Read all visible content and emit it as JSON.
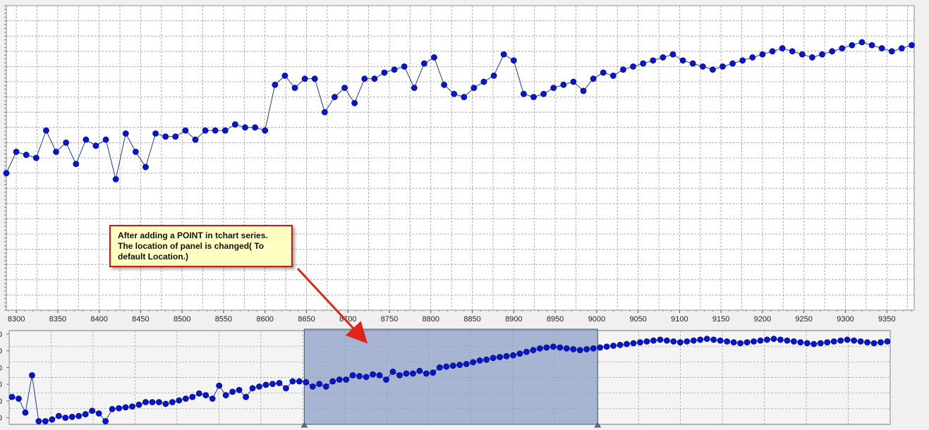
{
  "chart_data": [
    {
      "type": "line",
      "x_ticks": [
        8300,
        8350,
        8400,
        8450,
        8500,
        8550,
        8600,
        8650,
        8700,
        8750,
        8800,
        8850,
        8900,
        8950,
        9000,
        9050,
        9100,
        9150,
        9200,
        9250,
        9300,
        9350
      ],
      "xlim": [
        8288,
        9383
      ],
      "ylim": [
        0,
        100
      ],
      "grid": true,
      "marker": "circle",
      "series": [
        {
          "x": [
            8288,
            8300,
            8312,
            8324,
            8336,
            8348,
            8360,
            8372,
            8384,
            8396,
            8408,
            8420,
            8432,
            8444,
            8456,
            8468,
            8480,
            8492,
            8504,
            8516,
            8528,
            8540,
            8552,
            8564,
            8576,
            8588,
            8600,
            8612,
            8624,
            8636,
            8648,
            8660,
            8672,
            8684,
            8696,
            8708,
            8720,
            8732,
            8744,
            8756,
            8768,
            8780,
            8792,
            8804,
            8816,
            8828,
            8840,
            8852,
            8864,
            8876,
            8888,
            8900,
            8912,
            8924,
            8936,
            8948,
            8960,
            8972,
            8984,
            8996,
            9008,
            9020,
            9032,
            9044,
            9056,
            9068,
            9080,
            9092,
            9104,
            9116,
            9128,
            9140,
            9152,
            9164,
            9176,
            9188,
            9200,
            9212,
            9224,
            9236,
            9248,
            9260,
            9272,
            9284,
            9296,
            9308,
            9320,
            9332,
            9344,
            9356,
            9368,
            9380
          ],
          "values": [
            45,
            52,
            51,
            50,
            59,
            52,
            55,
            48,
            56,
            54,
            56,
            43,
            58,
            52,
            47,
            58,
            57,
            57,
            59,
            56,
            59,
            59,
            59,
            61,
            60,
            60,
            59,
            74,
            77,
            73,
            76,
            76,
            65,
            70,
            73,
            68,
            76,
            76,
            78,
            79,
            80,
            73,
            81,
            83,
            74,
            71,
            70,
            73,
            75,
            77,
            84,
            82,
            71,
            70,
            71,
            73,
            74,
            75,
            72,
            76,
            78,
            77,
            79,
            80,
            81,
            82,
            83,
            84,
            82,
            81,
            80,
            79,
            80,
            81,
            82,
            83,
            84,
            85,
            86,
            85,
            84,
            83,
            84,
            85,
            86,
            87,
            88,
            87,
            86,
            85,
            86,
            87
          ]
        }
      ]
    },
    {
      "type": "line",
      "x_ticks": [],
      "xlim": [
        0,
        100
      ],
      "ylim": [
        0,
        100
      ],
      "y_ticks": [
        "0",
        "0",
        "0",
        "0",
        "0",
        "0"
      ],
      "grid": true,
      "marker": "circle",
      "selection": {
        "from": 33.5,
        "to": 66.8
      },
      "series": [
        {
          "values": [
            30,
            28,
            12,
            55,
            2,
            2,
            4,
            8,
            6,
            7,
            8,
            10,
            14,
            11,
            2,
            16,
            17,
            18,
            19,
            21,
            24,
            24,
            24,
            22,
            24,
            26,
            28,
            30,
            34,
            32,
            28,
            43,
            32,
            36,
            38,
            30,
            40,
            42,
            44,
            45,
            46,
            40,
            48,
            48,
            47,
            42,
            45,
            42,
            48,
            50,
            50,
            55,
            54,
            53,
            56,
            55,
            50,
            59,
            55,
            57,
            57,
            60,
            57,
            58,
            64,
            65,
            66,
            67,
            68,
            70,
            72,
            73,
            75,
            76,
            77,
            78,
            80,
            82,
            84,
            86,
            87,
            88,
            87,
            86,
            85,
            84,
            85,
            86,
            87,
            88,
            89,
            90,
            91,
            92,
            93,
            94,
            95,
            96,
            95,
            94,
            93,
            94,
            95,
            96,
            97,
            96,
            95,
            94,
            93,
            92,
            93,
            94,
            95,
            96,
            97,
            96,
            95,
            94,
            93,
            92,
            91,
            92,
            93,
            94,
            95,
            96,
            95,
            94,
            93,
            92,
            93,
            94
          ]
        }
      ]
    }
  ],
  "callout": {
    "line1": "After adding a POINT in tchart series.",
    "line2": "The location of panel is changed( To",
    "line3": "default Location.)"
  },
  "colors": {
    "series": "#1f3a8f",
    "marker": "#0a14d8",
    "grid": "#9c9c9c",
    "selection_fill": "#8ea0c8",
    "arrow": "#e0241c"
  }
}
